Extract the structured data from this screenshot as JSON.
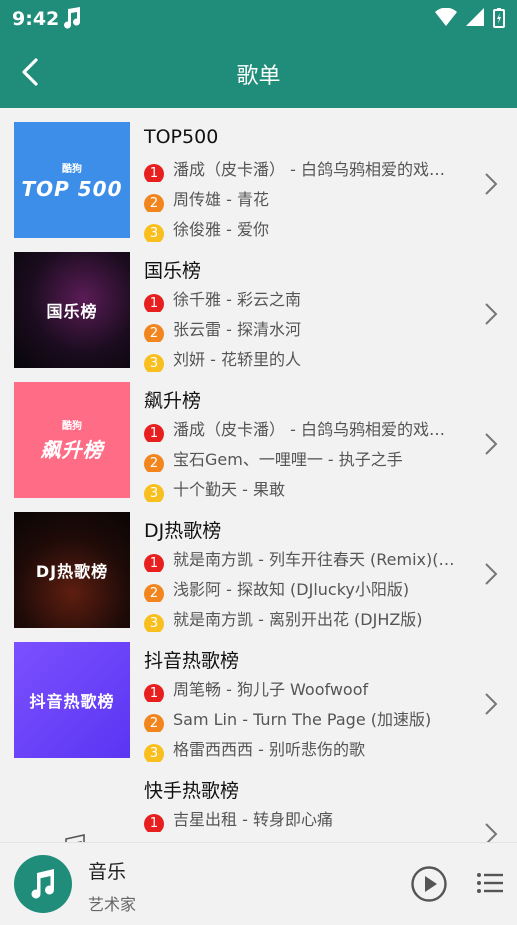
{
  "status": {
    "time": "9:42"
  },
  "header": {
    "title": "歌单"
  },
  "playlists": [
    {
      "title": "TOP500",
      "cover_small": "酷狗",
      "cover_main": "TOP 500",
      "songs": [
        "潘成（皮卡潘） - 白鸽乌鸦相爱的戏…",
        "周传雄 - 青花",
        "徐俊雅 - 爱你"
      ]
    },
    {
      "title": "国乐榜",
      "cover_main": "国乐榜",
      "songs": [
        "徐千雅 - 彩云之南",
        "张云雷 - 探清水河",
        "刘妍 - 花轿里的人"
      ]
    },
    {
      "title": "飙升榜",
      "cover_small": "酷狗",
      "cover_main": "飙升榜",
      "songs": [
        "潘成（皮卡潘） - 白鸽乌鸦相爱的戏…",
        "宝石Gem、一哩哩一 - 执子之手",
        "十个勤天 - 果敢"
      ]
    },
    {
      "title": "DJ热歌榜",
      "cover_main": "DJ热歌榜",
      "songs": [
        "就是南方凯 - 列车开往春天 (Remix)(…",
        "浅影阿 - 探故知 (DJlucky小阳版)",
        "就是南方凯 - 离别开出花 (DJHZ版)"
      ]
    },
    {
      "title": "抖音热歌榜",
      "cover_main": "抖音热歌榜",
      "songs": [
        "周笔畅 - 狗儿子 Woofwoof",
        "Sam Lin - Turn The Page (加速版)",
        "格雷西西西 - 别听悲伤的歌"
      ]
    },
    {
      "title": "快手热歌榜",
      "songs": [
        "吉星出租 - 转身即心痛"
      ]
    }
  ],
  "ranks": [
    "1",
    "2",
    "3"
  ],
  "player": {
    "title": "音乐",
    "artist": "艺术家"
  },
  "colors": {
    "primary": "#1f8d79",
    "rank1": "#e81f1f",
    "rank2": "#f2851d",
    "rank3": "#f9bf1e"
  }
}
